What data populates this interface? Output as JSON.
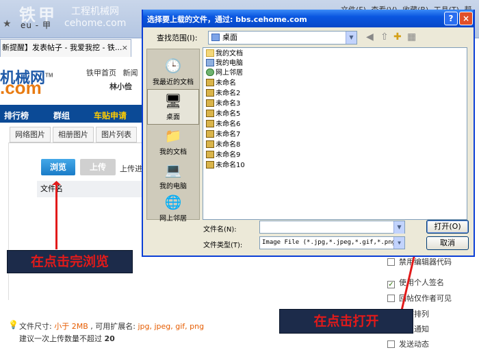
{
  "browser": {
    "address_fragment": "eu - 甲",
    "watermark_logo": "铁甲",
    "watermark_cn": "工程机械网",
    "watermark_en": "cehome.com",
    "menu": "文件(F) 查看(V) 收藏(B) 工具(T) 帮助",
    "tab_title": "新提醒】发表帖子 - 我爱我挖 - 铁...",
    "tab_close": "×"
  },
  "page": {
    "logo_text": "机械网",
    "logo_tm": "TM",
    "logo_com": ".com",
    "topnav": "铁甲首页 新闻",
    "username": "林小俭",
    "nav": [
      "排行榜",
      "群组",
      "车贴申请"
    ],
    "subtabs": [
      "网络图片",
      "相册图片",
      "图片列表"
    ],
    "browse_button": "浏览",
    "upload_button": "上传",
    "upload_progress": "上传进",
    "filename_header": "文件名",
    "hint_size_prefix": "文件尺寸: ",
    "hint_size_value": "小于 2MB",
    "hint_ext_prefix": " , 可用扩展名: ",
    "hint_ext_value": "jpg, jpeg, gif, png",
    "hint_count_prefix": "建议一次上传数量不超过 ",
    "hint_count_value": "20",
    "options": [
      {
        "label": "禁用编辑器代码",
        "checked": false
      },
      {
        "label": "使用个人签名",
        "checked": true
      },
      {
        "label": "回帖仅作者可见",
        "checked": false
      },
      {
        "label": "倒序排列",
        "checked": false
      },
      {
        "label": "回复通知",
        "checked": false
      },
      {
        "label": "发送动态",
        "checked": false
      }
    ]
  },
  "annotations": {
    "left": "在点击完浏览",
    "right": "在点击打开"
  },
  "dialog": {
    "title": "选择要上载的文件，通过: bbs.cehome.com",
    "help_btn": "?",
    "close_btn": "×",
    "lookin_label": "查找范围(I):",
    "lookin_value": "桌面",
    "places": [
      {
        "label": "我最近的文档",
        "icon": "clock-icon"
      },
      {
        "label": "桌面",
        "icon": "desktop-icon"
      },
      {
        "label": "我的文档",
        "icon": "folder-icon"
      },
      {
        "label": "我的电脑",
        "icon": "computer-icon"
      },
      {
        "label": "网上邻居",
        "icon": "network-icon"
      }
    ],
    "files": [
      {
        "name": "我的文档",
        "icon": "fold"
      },
      {
        "name": "我的电脑",
        "icon": "comp"
      },
      {
        "name": "网上邻居",
        "icon": "net"
      },
      {
        "name": "未命名",
        "icon": "img"
      },
      {
        "name": "未命名2",
        "icon": "img"
      },
      {
        "name": "未命名3",
        "icon": "img"
      },
      {
        "name": "未命名5",
        "icon": "img"
      },
      {
        "name": "未命名6",
        "icon": "img"
      },
      {
        "name": "未命名7",
        "icon": "img"
      },
      {
        "name": "未命名8",
        "icon": "img"
      },
      {
        "name": "未命名9",
        "icon": "img"
      },
      {
        "name": "未命名10",
        "icon": "img"
      }
    ],
    "filename_label": "文件名(N):",
    "filename_value": "",
    "filetype_label": "文件类型(T):",
    "filetype_value": "Image File (*.jpg,*.jpeg,*.gif,*.png)",
    "open_button": "打开(O)",
    "cancel_button": "取消"
  }
}
